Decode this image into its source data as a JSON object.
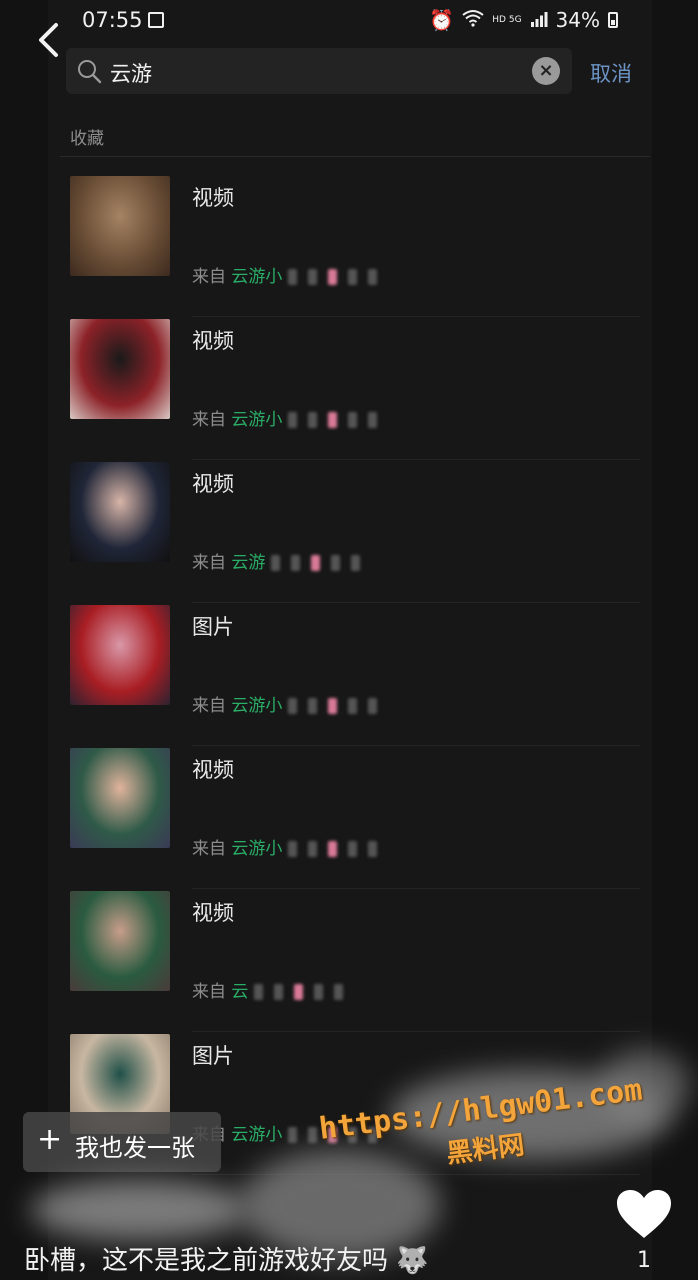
{
  "status_bar": {
    "time": "07:55",
    "battery": "34%",
    "network": "HD 5G"
  },
  "search": {
    "query": "云游",
    "cancel_label": "取消"
  },
  "section_label": "收藏",
  "items": [
    {
      "type": "视频",
      "source_prefix": "来自",
      "source_highlight": "云游小",
      "thumb_colors": [
        "#6a4e36",
        "#a58364",
        "#3c2a1e"
      ]
    },
    {
      "type": "视频",
      "source_prefix": "来自",
      "source_highlight": "云游小",
      "thumb_colors": [
        "#8c2228",
        "#1a1a1a",
        "#d9c9c5"
      ]
    },
    {
      "type": "视频",
      "source_prefix": "来自",
      "source_highlight": "云游",
      "thumb_colors": [
        "#202638",
        "#d8b5a8",
        "#101010"
      ]
    },
    {
      "type": "图片",
      "source_prefix": "来自",
      "source_highlight": "云游小",
      "thumb_colors": [
        "#a91e24",
        "#d998a8",
        "#2d2230"
      ]
    },
    {
      "type": "视频",
      "source_prefix": "来自",
      "source_highlight": "云游小",
      "thumb_colors": [
        "#2f5a48",
        "#e0b39c",
        "#3a3a55"
      ]
    },
    {
      "type": "视频",
      "source_prefix": "来自",
      "source_highlight": "云",
      "thumb_colors": [
        "#2a5b40",
        "#c79d8a",
        "#4a3b3a"
      ]
    },
    {
      "type": "图片",
      "source_prefix": "来自",
      "source_highlight": "云游小",
      "thumb_colors": [
        "#c8b7a2",
        "#205048",
        "#8a7a6a"
      ]
    }
  ],
  "post_button_label": "我也发一张",
  "watermark": {
    "url": "https://hlgw01.com",
    "name": "黑料网"
  },
  "caption": "卧槽，这不是我之前游戏好友吗",
  "like_count": "1",
  "colors": {
    "accent_green": "#2aae67",
    "cancel_blue": "#6b93c5",
    "watermark_orange": "#f3a43a"
  }
}
